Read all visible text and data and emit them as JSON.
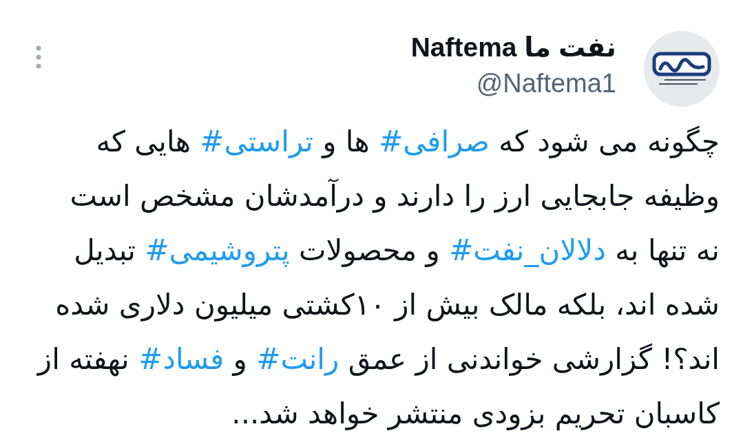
{
  "header": {
    "display_name": "نفت ما Naftema",
    "handle": "@Naftema1"
  },
  "tweet": {
    "lines": [
      [
        {
          "kind": "text",
          "text": "چگونه می شود که "
        },
        {
          "kind": "hashtag",
          "text": "#صرافی"
        },
        {
          "kind": "text",
          "text": " ها و "
        },
        {
          "kind": "hashtag",
          "text": "#تراستی"
        },
        {
          "kind": "text",
          "text": " هایی که"
        }
      ],
      [
        {
          "kind": "text",
          "text": "وظیفه جابجایی ارز را دارند و درآمدشان مشخص است"
        }
      ],
      [
        {
          "kind": "text",
          "text": "نه تنها به "
        },
        {
          "kind": "hashtag",
          "text": "#دلالان_نفت"
        },
        {
          "kind": "text",
          "text": " و محصولات "
        },
        {
          "kind": "hashtag",
          "text": "#پتروشیمی"
        },
        {
          "kind": "text",
          "text": " تبدیل"
        }
      ],
      [
        {
          "kind": "text",
          "text": "شده اند، بلکه مالک بیش از ۱۰کشتی میلیون دلاری شده"
        }
      ],
      [
        {
          "kind": "text",
          "text": "اند؟! گزارشی خواندنی از عمق "
        },
        {
          "kind": "hashtag",
          "text": "#رانت"
        },
        {
          "kind": "text",
          "text": " و "
        },
        {
          "kind": "hashtag",
          "text": "#فساد"
        },
        {
          "kind": "text",
          "text": " نهفته از"
        }
      ],
      [
        {
          "kind": "text",
          "text": "کاسبان تحریم بزودی منتشر خواهد شد..."
        }
      ]
    ]
  }
}
